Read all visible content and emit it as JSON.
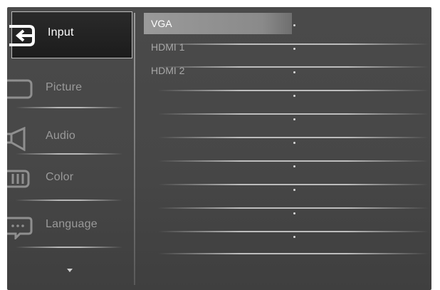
{
  "osd": {
    "menu": [
      {
        "id": "input",
        "label": "Input",
        "icon": "input-icon",
        "selected": true
      },
      {
        "id": "picture",
        "label": "Picture",
        "icon": "picture-icon",
        "selected": false
      },
      {
        "id": "audio",
        "label": "Audio",
        "icon": "audio-icon",
        "selected": false
      },
      {
        "id": "color",
        "label": "Color",
        "icon": "color-icon",
        "selected": false
      },
      {
        "id": "language",
        "label": "Language",
        "icon": "language-icon",
        "selected": false
      }
    ],
    "submenu": [
      {
        "label": "VGA",
        "selected": true
      },
      {
        "label": "HDMI 1",
        "selected": false
      },
      {
        "label": "HDMI 2",
        "selected": false
      },
      {
        "label": "",
        "selected": false
      },
      {
        "label": "",
        "selected": false
      },
      {
        "label": "",
        "selected": false
      },
      {
        "label": "",
        "selected": false
      },
      {
        "label": "",
        "selected": false
      },
      {
        "label": "",
        "selected": false
      },
      {
        "label": "",
        "selected": false
      }
    ],
    "scroll_icon": "chevron-down-icon",
    "colors": {
      "panel": "#474747",
      "selected_menu_bg": "#1c1c1c",
      "selected_submenu_bg": "#9a9a9a",
      "text_selected": "#ffffff",
      "text_normal": "#9a9a9a"
    }
  }
}
